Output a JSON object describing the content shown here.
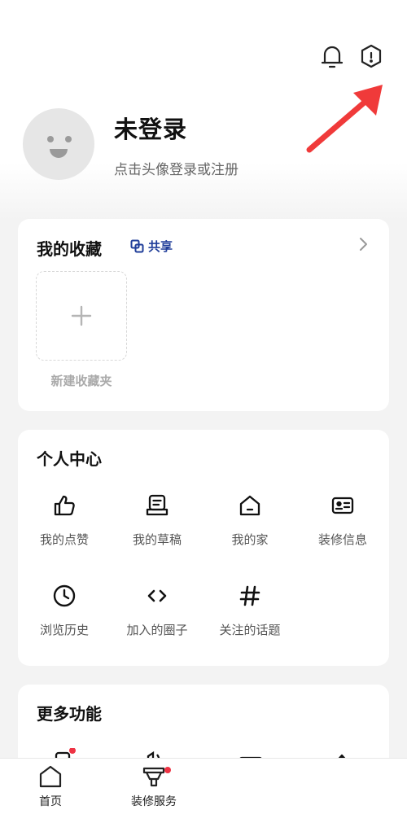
{
  "header": {
    "icons": [
      "bell-icon",
      "settings-hex-icon"
    ]
  },
  "profile": {
    "title": "未登录",
    "subtitle": "点击头像登录或注册"
  },
  "favorites": {
    "title": "我的收藏",
    "share_label": "共享",
    "new_folder_label": "新建收藏夹"
  },
  "personal_center": {
    "title": "个人中心",
    "items": [
      {
        "label": "我的点赞",
        "icon": "thumbs-up-icon"
      },
      {
        "label": "我的草稿",
        "icon": "draft-icon"
      },
      {
        "label": "我的家",
        "icon": "home-icon"
      },
      {
        "label": "装修信息",
        "icon": "id-card-icon"
      },
      {
        "label": "浏览历史",
        "icon": "clock-icon"
      },
      {
        "label": "加入的圈子",
        "icon": "code-brackets-icon"
      },
      {
        "label": "关注的话题",
        "icon": "hashtag-icon"
      }
    ]
  },
  "more_features": {
    "title": "更多功能"
  },
  "bottom_nav": {
    "items": [
      {
        "label": "首页",
        "icon": "home-tab-icon"
      },
      {
        "label": "装修服务",
        "icon": "service-tab-icon"
      }
    ]
  },
  "colors": {
    "accent_blue": "#1f3d99",
    "arrow_red": "#f03a3a",
    "badge_red": "#ee3344",
    "background": "#f3f3f3"
  }
}
